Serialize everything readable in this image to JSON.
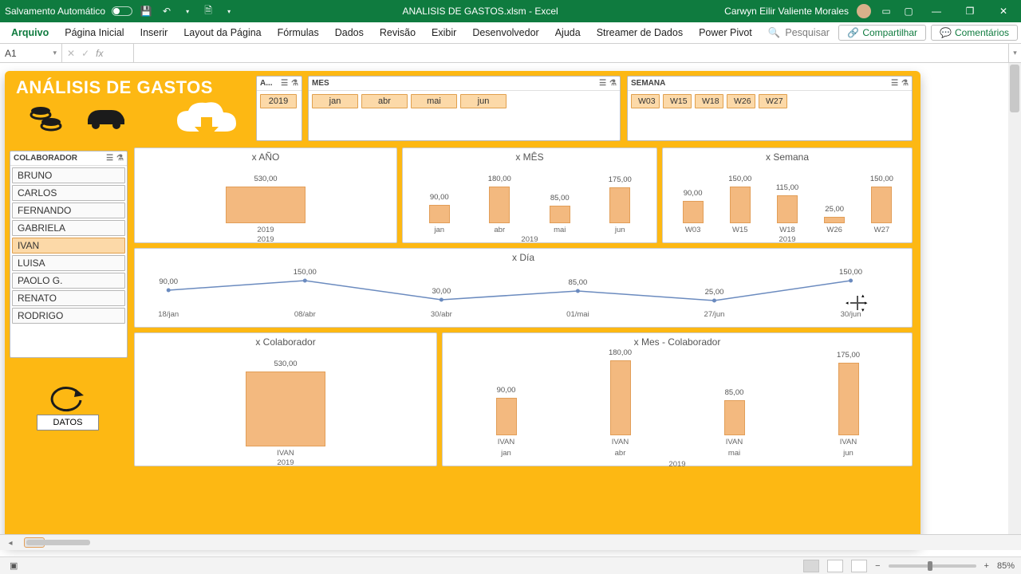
{
  "titlebar": {
    "autosave": "Salvamento Automático",
    "filename": "ANALISIS DE GASTOS.xlsm  -  Excel",
    "user": "Carwyn Eilir Valiente Morales"
  },
  "ribbon": {
    "tabs": [
      "Arquivo",
      "Página Inicial",
      "Inserir",
      "Layout da Página",
      "Fórmulas",
      "Dados",
      "Revisão",
      "Exibir",
      "Desenvolvedor",
      "Ajuda",
      "Streamer de Dados",
      "Power Pivot"
    ],
    "search_placeholder": "Pesquisar",
    "share": "Compartilhar",
    "comments": "Comentários"
  },
  "fx": {
    "name": "A1"
  },
  "dashboard_title": "ANÁLISIS DE GASTOS",
  "slicers": {
    "ano": {
      "label": "A...",
      "items": [
        "2019"
      ]
    },
    "mes": {
      "label": "MES",
      "items": [
        "jan",
        "abr",
        "mai",
        "jun"
      ]
    },
    "sem": {
      "label": "SEMANA",
      "items": [
        "W03",
        "W15",
        "W18",
        "W26",
        "W27"
      ]
    },
    "colab": {
      "label": "COLABORADOR",
      "items": [
        "BRUNO",
        "CARLOS",
        "FERNANDO",
        "GABRIELA",
        "IVAN",
        "LUISA",
        "PAOLO G.",
        "RENATO",
        "RODRIGO"
      ],
      "active": "IVAN"
    }
  },
  "datos_btn": "DATOS",
  "status": {
    "zoom": "85%"
  },
  "chart_data": [
    {
      "id": "ano",
      "type": "bar",
      "title": "x AÑO",
      "categories": [
        "2019"
      ],
      "values": [
        530.0
      ],
      "axis_below": "2019"
    },
    {
      "id": "mes",
      "type": "bar",
      "title": "x MÊS",
      "categories": [
        "jan",
        "abr",
        "mai",
        "jun"
      ],
      "values": [
        90.0,
        180.0,
        85.0,
        175.0
      ],
      "axis_below": "2019"
    },
    {
      "id": "sem",
      "type": "bar",
      "title": "x Semana",
      "categories": [
        "W03",
        "W15",
        "W18",
        "W26",
        "W27"
      ],
      "values": [
        90.0,
        150.0,
        115.0,
        25.0,
        150.0
      ],
      "axis_below": "2019"
    },
    {
      "id": "dia",
      "type": "line",
      "title": "x Día",
      "categories": [
        "18/jan",
        "08/abr",
        "30/abr",
        "01/mai",
        "27/jun",
        "30/jun"
      ],
      "values": [
        90.0,
        150.0,
        30.0,
        85.0,
        25.0,
        150.0
      ]
    },
    {
      "id": "colab",
      "type": "bar",
      "title": "x Colaborador",
      "categories": [
        "IVAN"
      ],
      "values": [
        530.0
      ],
      "axis_below": "2019"
    },
    {
      "id": "mescolab",
      "type": "bar",
      "title": "x Mes - Colaborador",
      "categories": [
        "IVAN",
        "IVAN",
        "IVAN",
        "IVAN"
      ],
      "sub": [
        "jan",
        "abr",
        "mai",
        "jun"
      ],
      "values": [
        90.0,
        180.0,
        85.0,
        175.0
      ],
      "axis_below": "2019"
    }
  ]
}
